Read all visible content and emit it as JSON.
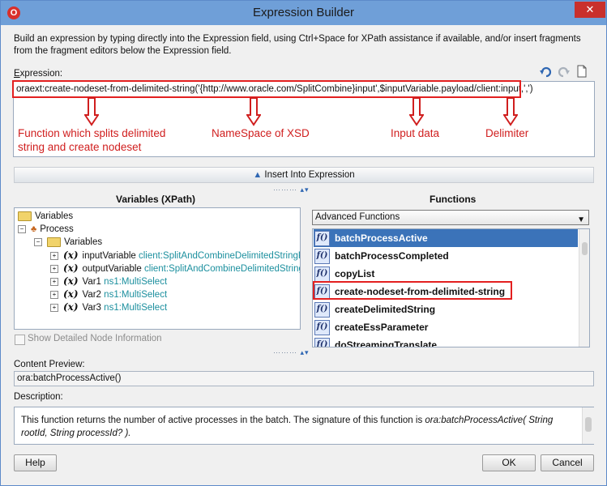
{
  "window": {
    "title": "Expression Builder",
    "close_glyph": "✕",
    "app_icon_glyph": "O"
  },
  "intro_text": "Build an expression by typing directly into the Expression field, using Ctrl+Space for XPath assistance if available, and/or insert fragments from the fragment editors below the Expression field.",
  "expression": {
    "label": "Expression:",
    "value": "oraext:create-nodeset-from-delimited-string('{http://www.oracle.com/SplitCombine}input',$inputVariable.payload/client:input,',')",
    "tool_icons": [
      "undo-icon",
      "redo-icon",
      "new-document-icon"
    ]
  },
  "annotations": [
    {
      "line1": "Function which splits delimited",
      "line2": "string and create nodeset"
    },
    {
      "line1": "NameSpace of XSD"
    },
    {
      "line1": "Input data"
    },
    {
      "line1": "Delimiter"
    }
  ],
  "insert_button": "Insert Into Expression",
  "variables": {
    "title": "Variables (XPath)",
    "root": "Variables",
    "process": "Process",
    "sub": "Variables",
    "items": [
      {
        "name": "inputVariable",
        "type": "client:SplitAndCombineDelimitedStringProce"
      },
      {
        "name": "outputVariable",
        "type": "client:SplitAndCombineDelimitedStringProc"
      },
      {
        "name": "Var1",
        "type": "ns1:MultiSelect"
      },
      {
        "name": "Var2",
        "type": "ns1:MultiSelect"
      },
      {
        "name": "Var3",
        "type": "ns1:MultiSelect"
      }
    ],
    "show_detail_label": "Show Detailed Node Information"
  },
  "functions": {
    "title": "Functions",
    "category": "Advanced Functions",
    "items": [
      "batchProcessActive",
      "batchProcessCompleted",
      "copyList",
      "create-nodeset-from-delimited-string",
      "createDelimitedString",
      "createEssParameter",
      "doStreamingTranslate"
    ],
    "selected_index": 0,
    "icon_glyph": "f()"
  },
  "content_preview": {
    "label": "Content Preview:",
    "value": "ora:batchProcessActive()"
  },
  "description": {
    "label": "Description:",
    "text": "This function returns the number of active processes in the batch. The signature of this function is ",
    "signature": "ora:batchProcessActive( String rootId, String processId? )."
  },
  "buttons": {
    "help": "Help",
    "ok": "OK",
    "cancel": "Cancel"
  },
  "colors": {
    "titlebar": "#6f9fd8",
    "selection": "#3b73b9",
    "annotation": "#d01e1e",
    "teal_type": "#1b8f9e"
  }
}
